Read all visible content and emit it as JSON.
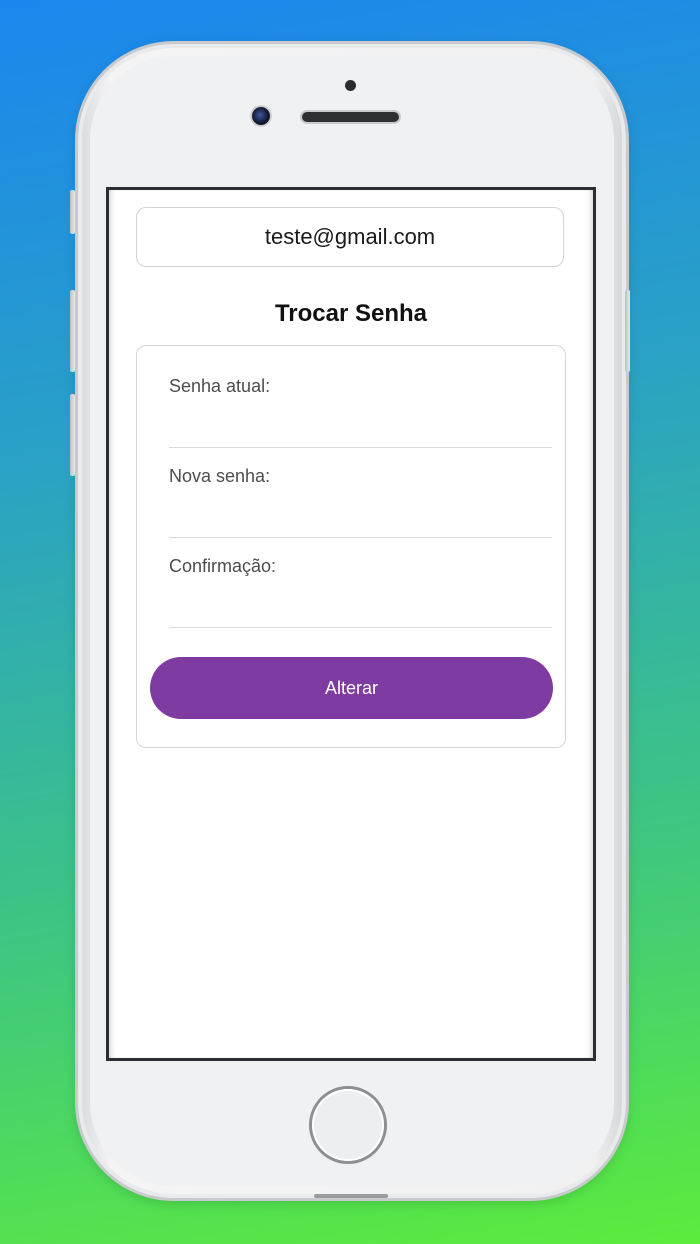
{
  "account": {
    "email": "teste@gmail.com"
  },
  "page": {
    "title": "Trocar Senha"
  },
  "form": {
    "fields": [
      {
        "label": "Senha atual:",
        "value": ""
      },
      {
        "label": "Nova senha:",
        "value": ""
      },
      {
        "label": "Confirmação:",
        "value": ""
      }
    ],
    "submit_label": "Alterar"
  },
  "colors": {
    "accent": "#7e3ba1",
    "background_gradient_top": "#1b86ee",
    "background_gradient_bottom": "#5bec3c"
  }
}
